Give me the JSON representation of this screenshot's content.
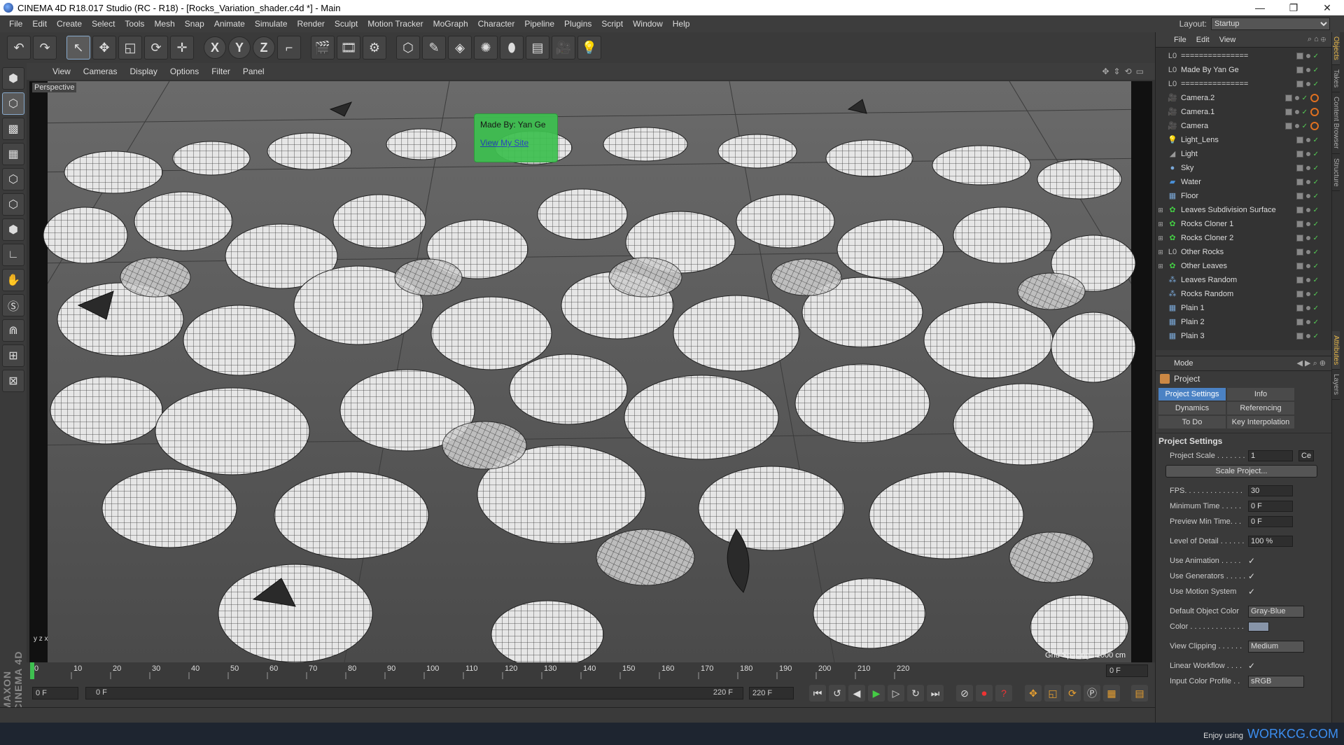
{
  "window": {
    "title": "CINEMA 4D R18.017 Studio (RC - R18) - [Rocks_Variation_shader.c4d *] - Main",
    "controls": [
      "—",
      "❐",
      "✕"
    ]
  },
  "menu": [
    "File",
    "Edit",
    "Create",
    "Select",
    "Tools",
    "Mesh",
    "Snap",
    "Animate",
    "Simulate",
    "Render",
    "Sculpt",
    "Motion Tracker",
    "MoGraph",
    "Character",
    "Pipeline",
    "Plugins",
    "Script",
    "Window",
    "Help"
  ],
  "layout": {
    "label": "Layout:",
    "value": "Startup"
  },
  "viewport_menu": [
    "View",
    "Cameras",
    "Display",
    "Options",
    "Filter",
    "Panel"
  ],
  "viewport": {
    "name": "Perspective",
    "grid_spacing": "Grid Spacing : 1000 cm",
    "axis": "y z x"
  },
  "tooltip": {
    "title": "Made By: Yan Ge",
    "link": "View My Site"
  },
  "toolbar": {
    "x": "X",
    "y": "Y",
    "z": "Z"
  },
  "timeline": {
    "ticks": [
      "0",
      "10",
      "20",
      "30",
      "40",
      "50",
      "60",
      "70",
      "80",
      "90",
      "100",
      "110",
      "120",
      "130",
      "140",
      "150",
      "160",
      "170",
      "180",
      "190",
      "200",
      "210",
      "220"
    ],
    "current_frame": "0 F"
  },
  "transport": {
    "start": "0 F",
    "range_start": "0 F",
    "range_end": "220 F",
    "end": "220 F"
  },
  "object_manager": {
    "menu": [
      "File",
      "Edit",
      "View"
    ],
    "objects": [
      {
        "name": "===============",
        "icon": "L0",
        "color": "#bbb"
      },
      {
        "name": "Made By Yan Ge",
        "icon": "L0",
        "color": "#bbb"
      },
      {
        "name": "===============",
        "icon": "L0",
        "color": "#bbb"
      },
      {
        "name": "Camera.2",
        "icon": "🎥",
        "color": "#999"
      },
      {
        "name": "Camera.1",
        "icon": "🎥",
        "color": "#999"
      },
      {
        "name": "Camera",
        "icon": "🎥",
        "color": "#999"
      },
      {
        "name": "Light_Lens",
        "icon": "💡",
        "color": "#999"
      },
      {
        "name": "Light",
        "icon": "◢",
        "color": "#999"
      },
      {
        "name": "Sky",
        "icon": "●",
        "color": "#7aa8d8"
      },
      {
        "name": "Water",
        "icon": "▰",
        "color": "#4a90d8"
      },
      {
        "name": "Floor",
        "icon": "▦",
        "color": "#7aa8d8"
      },
      {
        "name": "Leaves Subdivision Surface",
        "icon": "✿",
        "color": "#4c4"
      },
      {
        "name": "Rocks Cloner 1",
        "icon": "✿",
        "color": "#4c4"
      },
      {
        "name": "Rocks Cloner 2",
        "icon": "✿",
        "color": "#4c4"
      },
      {
        "name": "Other Rocks",
        "icon": "L0",
        "color": "#bbb"
      },
      {
        "name": "Other Leaves",
        "icon": "✿",
        "color": "#4c4"
      },
      {
        "name": "Leaves Random",
        "icon": "⁂",
        "color": "#7aa8d8"
      },
      {
        "name": "Rocks Random",
        "icon": "⁂",
        "color": "#7aa8d8"
      },
      {
        "name": "Plain 1",
        "icon": "▦",
        "color": "#7aa8d8"
      },
      {
        "name": "Plain 2",
        "icon": "▦",
        "color": "#7aa8d8"
      },
      {
        "name": "Plain 3",
        "icon": "▦",
        "color": "#7aa8d8"
      }
    ]
  },
  "attributes": {
    "menu": [
      "Mode"
    ],
    "header": "Project",
    "tabs": [
      "Project Settings",
      "Info",
      "Dynamics",
      "Referencing",
      "To Do",
      "Key Interpolation"
    ],
    "section": "Project Settings",
    "project_scale": {
      "label": "Project Scale . . . . . . .",
      "value": "1",
      "unit": "Ce"
    },
    "scale_button": "Scale Project...",
    "fps": {
      "label": "FPS. . . . . . . . . . . . . .",
      "value": "30"
    },
    "min_time": {
      "label": "Minimum Time . . . . .",
      "value": "0 F"
    },
    "preview_min": {
      "label": "Preview Min Time. . .",
      "value": "0 F"
    },
    "lod": {
      "label": "Level of Detail . . . . . .",
      "value": "100 %"
    },
    "use_anim": {
      "label": "Use Animation . . . . .",
      "value": "✓"
    },
    "use_gen": {
      "label": "Use Generators . . . . .",
      "value": "✓"
    },
    "use_motion": {
      "label": "Use Motion System",
      "value": "✓"
    },
    "def_color": {
      "label": "Default Object Color",
      "value": "Gray-Blue"
    },
    "color": {
      "label": "Color . . . . . . . . . . . . ."
    },
    "clipping": {
      "label": "View Clipping . . . . . .",
      "value": "Medium"
    },
    "linear": {
      "label": "Linear Workflow . . . .",
      "value": "✓"
    },
    "profile": {
      "label": "Input Color Profile . .",
      "value": "sRGB"
    }
  },
  "side_tabs": [
    "Objects",
    "Takes",
    "Content Browser",
    "Structure",
    "Attributes",
    "Layers"
  ],
  "footer": {
    "enjoy": "Enjoy using",
    "brand": "WORKCG.COM"
  },
  "logo_text": "MAXON CINEMA 4D"
}
